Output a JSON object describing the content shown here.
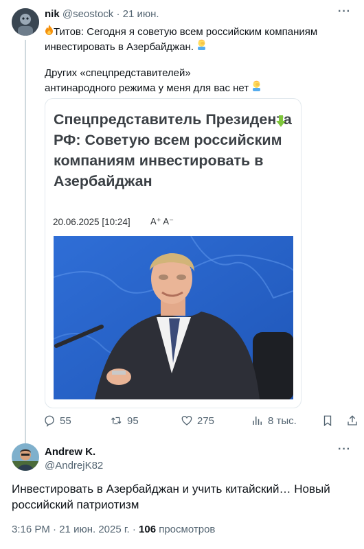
{
  "tweet": {
    "author_name": "nik",
    "author_handle": "@seostock",
    "separator": "·",
    "date": "21 июн.",
    "line1_icon": "fire-emoji",
    "line1": "Титов: Сегодня я советую всем российским компаниям инвестировать в Азербайджан.",
    "line1_end_icon": "facepalm-emoji",
    "line2": "Других «спецпредставителей»",
    "line3": "антинародного режима у меня для вас нет",
    "line3_end_icon": "facepalm-emoji"
  },
  "quoted": {
    "title": "Спецпредставитель Президента РФ: Советую всем российским компаниям инвестировать в Азербайджан",
    "date": "20.06.2025 [10:24]",
    "font_controls": "A⁺ A⁻",
    "arrow_color": "#7fc63b"
  },
  "actions": {
    "replies": "55",
    "reposts": "95",
    "likes": "275",
    "views": "8 тыс."
  },
  "reply": {
    "author_name": "Andrew K.",
    "author_handle": "@AndrejK82",
    "text": "Инвестировать в Азербайджан и учить китайский… Новый российский патриотизм",
    "time": "3:16 PM",
    "separator": "·",
    "date": "21 июн. 2025 г.",
    "views_count": "106",
    "views_label": "просмотров"
  },
  "colors": {
    "accent_muted": "#536471",
    "text": "#0f1419",
    "border": "#cfd9de"
  }
}
